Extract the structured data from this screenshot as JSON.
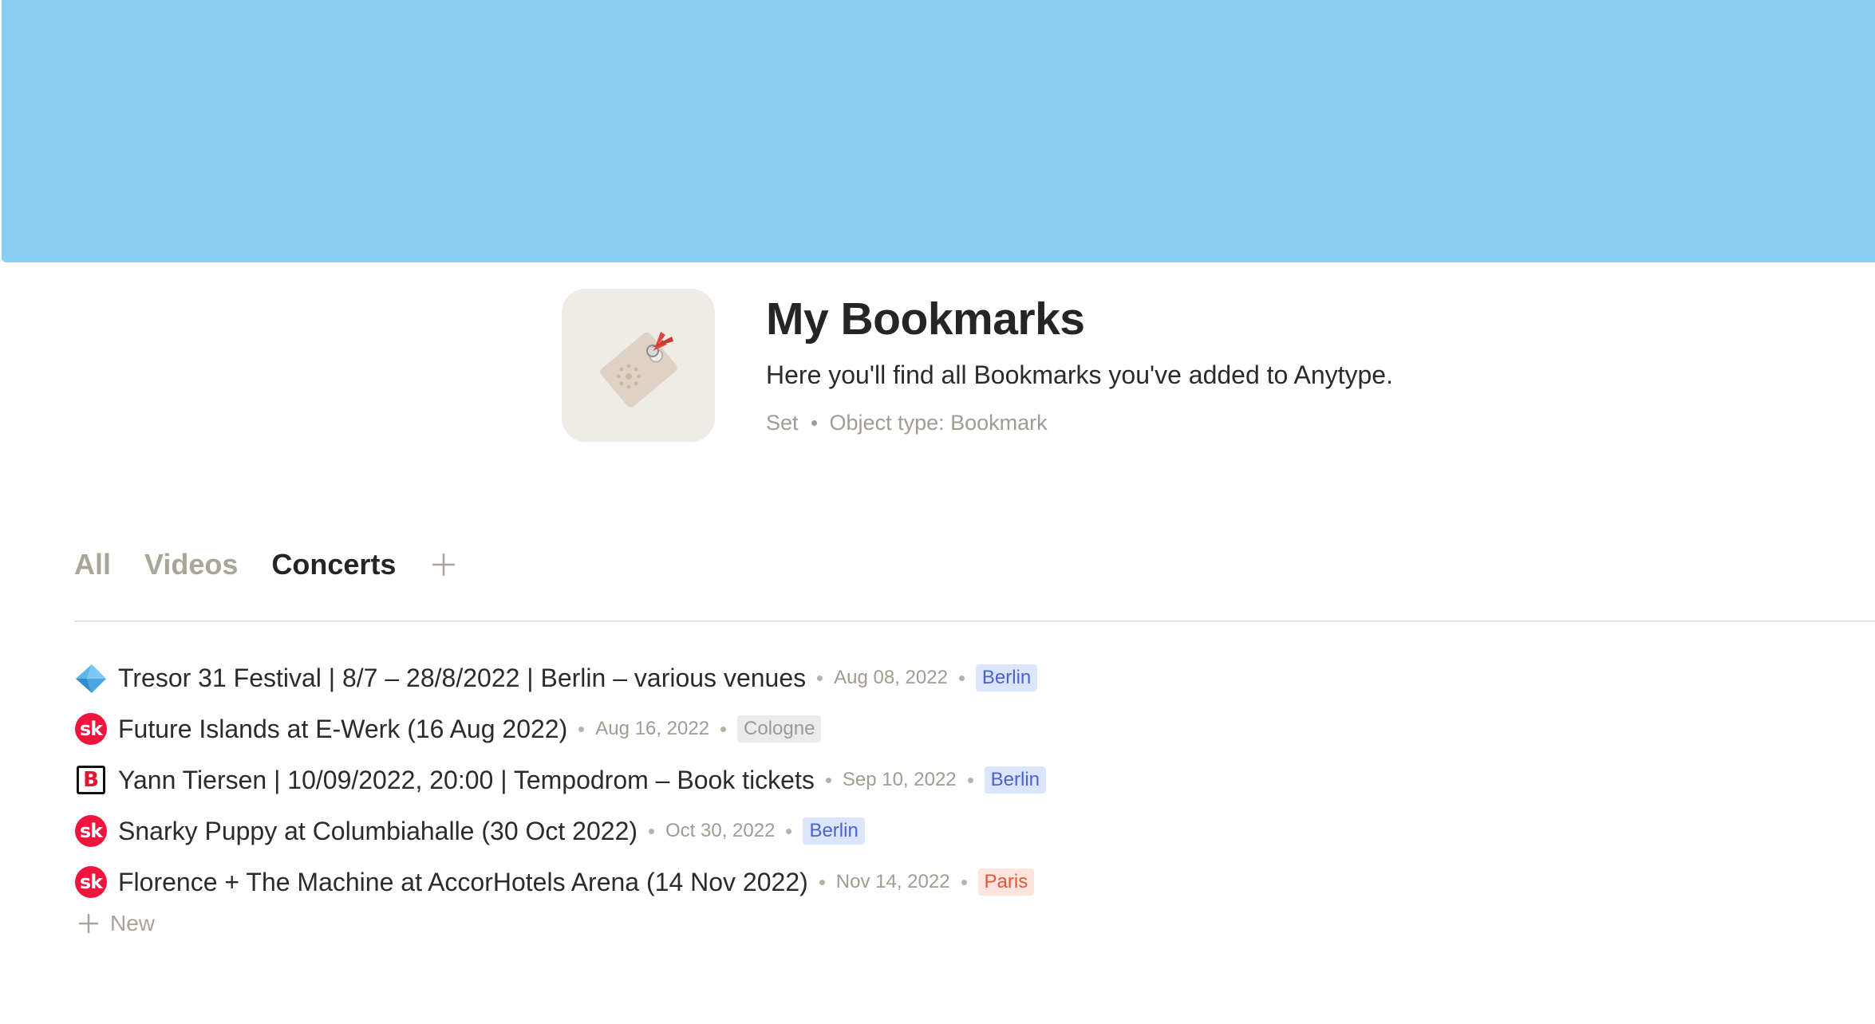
{
  "header": {
    "title": "My Bookmarks",
    "description": "Here you'll find all Bookmarks you've added to Anytype.",
    "meta_type": "Set",
    "meta_object_type": "Object type: Bookmark",
    "cover_color": "#89cdf2",
    "icon": "bookmark-tag-icon"
  },
  "tabs": [
    {
      "label": "All",
      "active": false
    },
    {
      "label": "Videos",
      "active": false
    },
    {
      "label": "Concerts",
      "active": true
    }
  ],
  "rows": [
    {
      "icon": "tresor-arrow-icon",
      "title": "Tresor 31 Festival | 8/7 – 28/8/2022 | Berlin – various venues",
      "date": "Aug 08, 2022",
      "tag": "Berlin",
      "tag_color": "#dbe5fb"
    },
    {
      "icon": "songkick-icon",
      "title": "Future Islands at E-Werk (16 Aug 2022)",
      "date": "Aug 16, 2022",
      "tag": "Cologne",
      "tag_color": "#ebebeb"
    },
    {
      "icon": "b-logo-icon",
      "title": "Yann Tiersen | 10/09/2022, 20:00 | Tempodrom – Book tickets",
      "date": "Sep 10, 2022",
      "tag": "Berlin",
      "tag_color": "#dbe5fb"
    },
    {
      "icon": "songkick-icon",
      "title": "Snarky Puppy at Columbiahalle (30 Oct 2022)",
      "date": "Oct 30, 2022",
      "tag": "Berlin",
      "tag_color": "#dbe5fb"
    },
    {
      "icon": "songkick-icon",
      "title": "Florence + The Machine at AccorHotels Arena (14 Nov 2022)",
      "date": "Nov 14, 2022",
      "tag": "Paris",
      "tag_color": "#fde4dd"
    }
  ],
  "new_label": "New",
  "songkick_text": "sk",
  "b_logo_text": "B"
}
